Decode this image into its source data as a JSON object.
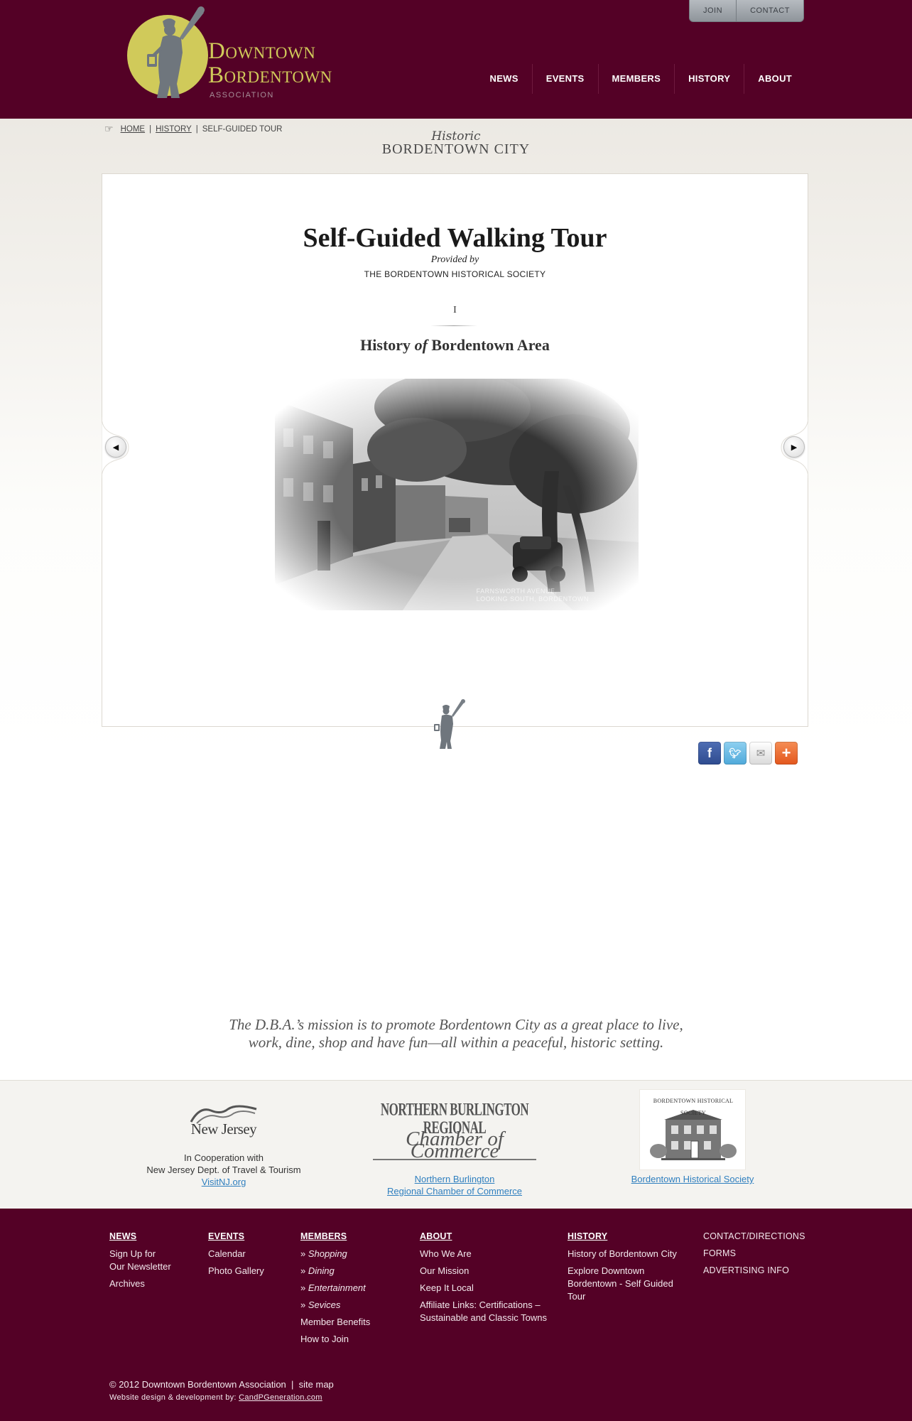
{
  "header": {
    "logo_line1": "Downtown",
    "logo_line2": "Bordentown",
    "logo_sub": "ASSOCIATION",
    "util": {
      "join": "JOIN",
      "contact": "CONTACT"
    },
    "nav": [
      "NEWS",
      "EVENTS",
      "MEMBERS",
      "HISTORY",
      "ABOUT"
    ],
    "brand_color": "#540126",
    "accent_color": "#d0ca5a"
  },
  "breadcrumb": {
    "home": "HOME",
    "history": "HISTORY",
    "current": "SELF-GUIDED TOUR",
    "separator": "|"
  },
  "section": {
    "script": "Historic",
    "title": "BORDENTOWN CITY"
  },
  "tour": {
    "title": "Self-Guided Walking Tour",
    "provided_by": "Provided by",
    "society": "THE BORDENTOWN HISTORICAL SOCIETY",
    "numeral": "I",
    "chapter_pre": "History ",
    "chapter_of": "of",
    "chapter_post": " Bordentown Area",
    "photo_caption_1": "FARNSWORTH AVENUE,",
    "photo_caption_2": "LOOKING SOUTH, BORDENTOWN"
  },
  "icons": {
    "prev": "arrow-left-icon",
    "next": "arrow-right-icon",
    "share": [
      "facebook-icon",
      "twitter-icon",
      "email-icon",
      "add-icon"
    ]
  },
  "mission": {
    "line1": "The D.B.A.’s mission is to promote Bordentown City as a great place to live,",
    "line2": "work, dine, shop and have fun—all within a peaceful, historic setting."
  },
  "partners": {
    "nj": {
      "logo": "New Jersey",
      "text1": "In Cooperation with",
      "text2": "New Jersey Dept. of Travel & Tourism",
      "link": "VisitNJ.org"
    },
    "nb": {
      "logo1": "NORTHERN BURLINGTON REGIONAL",
      "logo2": "Chamber of Commerce",
      "link1": "Northern Burlington",
      "link2": "Regional Chamber of Commerce"
    },
    "hs": {
      "logo": "BORDENTOWN HISTORICAL SOCIETY",
      "link": "Bordentown Historical Society"
    }
  },
  "footer": {
    "news": {
      "head": "NEWS",
      "items": [
        "Sign Up for",
        "Our Newsletter",
        "Archives"
      ]
    },
    "events": {
      "head": "EVENTS",
      "items": [
        "Calendar",
        "Photo Gallery"
      ]
    },
    "members": {
      "head": "MEMBERS",
      "items": [
        "Shopping",
        "Dining",
        "Entertainment",
        "Sevices",
        "Member Benefits",
        "How to Join"
      ]
    },
    "about": {
      "head": "ABOUT",
      "items": [
        "Who We Are",
        "Our Mission",
        "Keep It Local",
        "Affiliate Links: Certifications –",
        "Sustainable and Classic Towns"
      ]
    },
    "history": {
      "head": "HISTORY",
      "items": [
        "History of Bordentown City",
        "Explore Downtown",
        "Bordentown - Self Guided",
        "Tour"
      ]
    },
    "misc": [
      "CONTACT/DIRECTIONS",
      "FORMS",
      "ADVERTISING INFO"
    ],
    "copyright": "© 2012 Downtown Bordentown Association",
    "sitemap_sep": "|",
    "sitemap": "site map",
    "credit_pre": "Website design & development by:",
    "credit_link": "CandPGeneration.com"
  }
}
